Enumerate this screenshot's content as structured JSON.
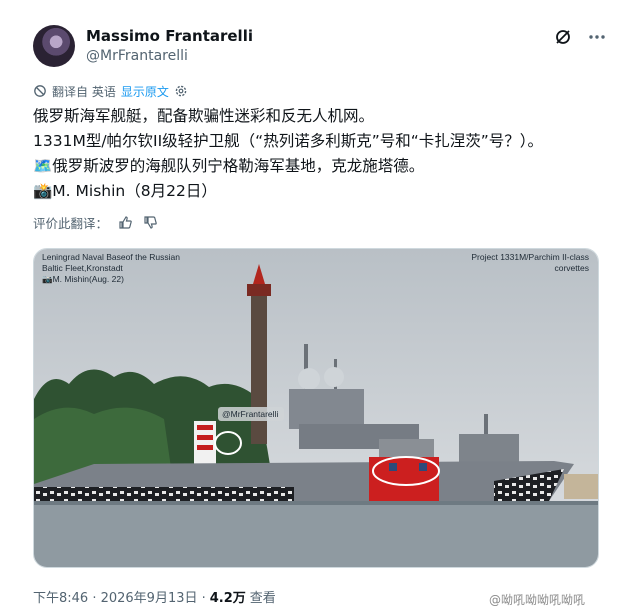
{
  "author": {
    "name": "Massimo Frantarelli",
    "handle": "@MrFrantarelli"
  },
  "icons": {
    "grok": "grok-icon",
    "more": "more-horizontal-icon",
    "translate": "translate-icon",
    "settings": "gear-icon",
    "thumbs_up": "thumbs-up-icon",
    "thumbs_down": "thumbs-down-icon"
  },
  "translation": {
    "label": "翻译自 英语",
    "show_original": "显示原文"
  },
  "tweet": {
    "lines": [
      "俄罗斯海军舰艇，配备欺骗性迷彩和反无人机网。",
      "1331M型/帕尔钦II级轻护卫舰（“热列诺多利斯克”号和“卡扎涅茨”号？）。",
      "🗺️俄罗斯波罗的海舰队列宁格勒海军基地，克龙施塔德。",
      "📸M. Mishin（8月22日）"
    ]
  },
  "rate": {
    "label": "评价此翻译："
  },
  "photo": {
    "caption_left": [
      "Leningrad Naval Baseof the Russian",
      "Baltic Fleet,Kronstadt",
      "📷M. Mishin(Aug. 22)"
    ],
    "caption_right": [
      "Project 1331M/Parchim II-class",
      "corvettes"
    ],
    "tag": "@MrFrantarelli",
    "colors": {
      "sky": "#c9ced3",
      "water": "#8f9aa1",
      "hull_gray": "#7b8189",
      "hull_red": "#cc1f1f"
    }
  },
  "footer": {
    "time": "下午8:46 · 2026年9月13日 ·",
    "views": "4.2万",
    "views_label": "查看"
  },
  "watermark": "@呦吼呦呦吼呦吼"
}
